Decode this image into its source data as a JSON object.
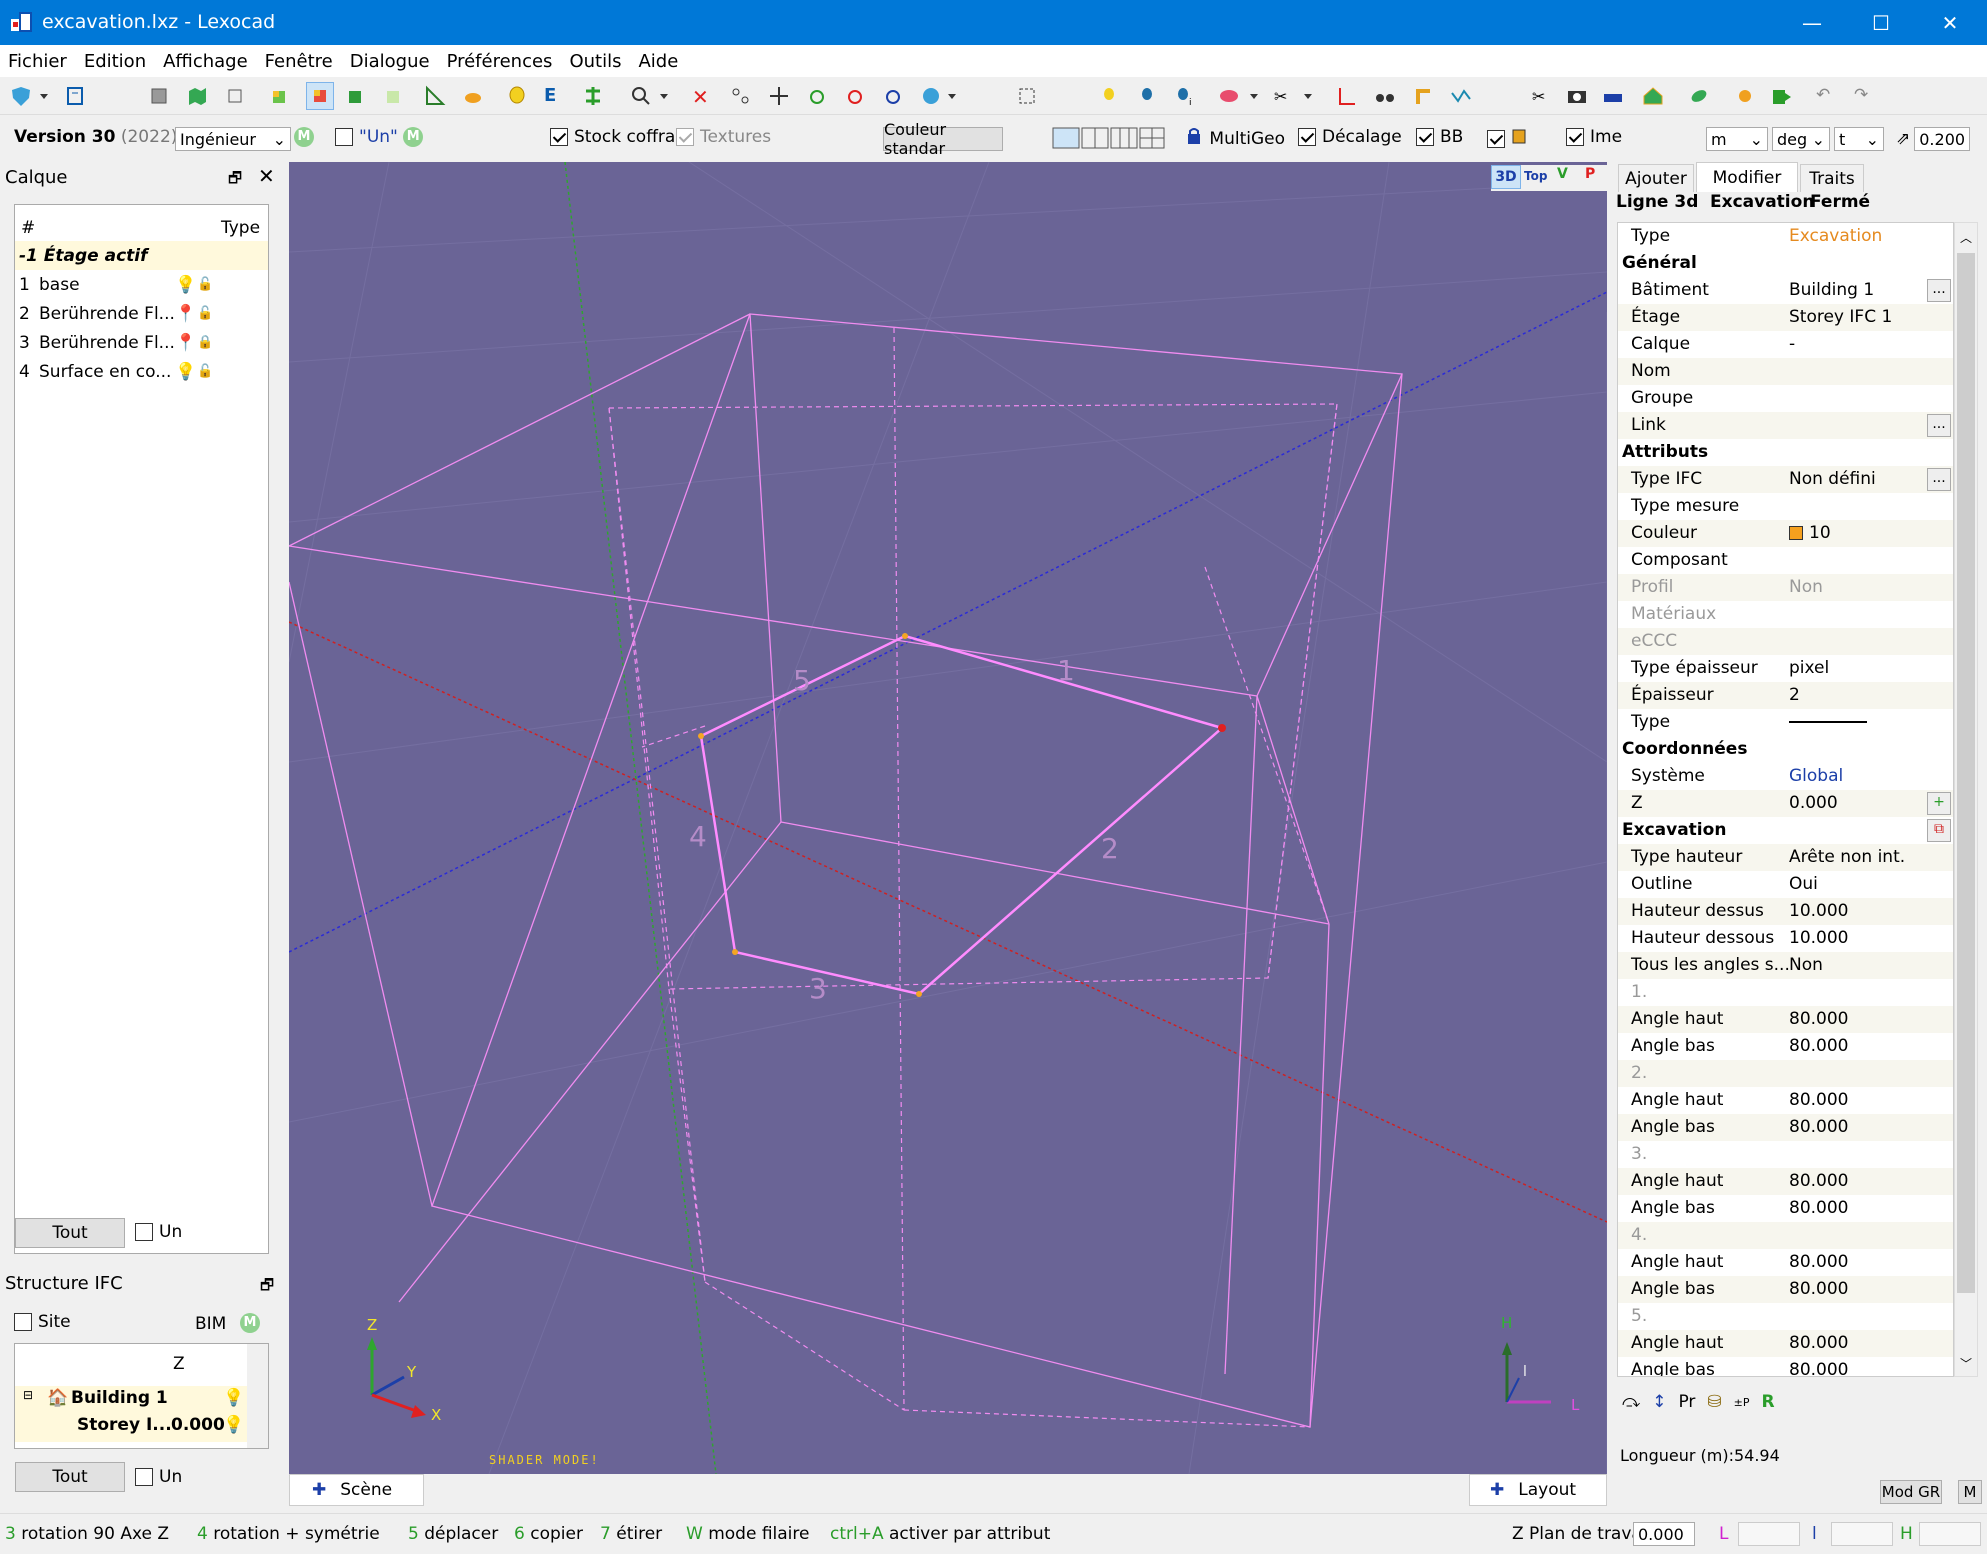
{
  "window": {
    "title": "excavation.lxz - Lexocad",
    "minimize": "—",
    "maximize": "☐",
    "close": "✕"
  },
  "menu": [
    "Fichier",
    "Edition",
    "Affichage",
    "Fenêtre",
    "Dialogue",
    "Préférences",
    "Outils",
    "Aide"
  ],
  "optbar": {
    "version_label": "Version 30",
    "version_year": "(2022)",
    "profile": "Ingénieur",
    "un_label": "\"Un\"",
    "m_badge": "M",
    "stock": "Stock coffrag",
    "textures": "Textures",
    "couleur": "Couleur standar",
    "multigeo": "MultiGeo",
    "decalage": "Décalage",
    "bb": "BB",
    "ime": "Ime",
    "unit_len": "m",
    "unit_ang": "deg",
    "unit_mass": "t",
    "value": "0.200"
  },
  "calque": {
    "title": "Calque",
    "col_num": "#",
    "col_type": "Type",
    "active": "-1 Étage actif",
    "rows": [
      {
        "n": "1",
        "name": "base"
      },
      {
        "n": "2",
        "name": "Berührende Fl..."
      },
      {
        "n": "3",
        "name": "Berührende Fl..."
      },
      {
        "n": "4",
        "name": "Surface en co..."
      }
    ],
    "tout": "Tout",
    "un": "Un"
  },
  "ifc": {
    "title": "Structure IFC",
    "site": "Site",
    "bim": "BIM",
    "m": "M",
    "col_z": "Z",
    "building": "Building 1",
    "storey": "Storey I...",
    "storey_z": "0.000",
    "tout": "Tout",
    "un": "Un"
  },
  "viewport": {
    "view_3d": "3D",
    "view_top": "Top",
    "view_v": "V",
    "view_p": "P",
    "shader": "SHADER MODE!",
    "edge_labels": [
      "1",
      "2",
      "3",
      "4",
      "5"
    ],
    "axis_z": "Z",
    "axis_y": "Y",
    "axis_x": "X",
    "axis_h": "H",
    "axis_l": "L",
    "axis_i": "l"
  },
  "bottom_tabs": {
    "scene": "Scène",
    "layout": "Layout"
  },
  "right": {
    "tabs": [
      "Ajouter",
      "Modifier",
      "Traits"
    ],
    "header": {
      "a": "Ligne 3d",
      "b": "Excavation",
      "c": "Fermé"
    },
    "rows": [
      {
        "k": "Type",
        "v": "Excavation",
        "kind": "orange"
      },
      {
        "k": "Général",
        "kind": "sec"
      },
      {
        "k": "Bâtiment",
        "v": "Building 1",
        "dots": true
      },
      {
        "k": "Étage",
        "v": "Storey IFC 1"
      },
      {
        "k": "Calque",
        "v": "-"
      },
      {
        "k": "Nom",
        "v": ""
      },
      {
        "k": "Groupe",
        "v": ""
      },
      {
        "k": "Link",
        "v": "",
        "dots": true
      },
      {
        "k": "Attributs",
        "kind": "sec"
      },
      {
        "k": "Type IFC",
        "v": "Non défini",
        "dots": true
      },
      {
        "k": "Type mesure",
        "v": ""
      },
      {
        "k": "Couleur",
        "v": "10",
        "kind": "color"
      },
      {
        "k": "Composant",
        "v": ""
      },
      {
        "k": "Profil",
        "v": "Non",
        "kind": "gray"
      },
      {
        "k": "Matériaux",
        "v": "",
        "kind": "gray"
      },
      {
        "k": "eCCC",
        "v": "",
        "kind": "gray"
      },
      {
        "k": "Type épaisseur",
        "v": "pixel"
      },
      {
        "k": "Épaisseur",
        "v": "2"
      },
      {
        "k": "Type",
        "v": "",
        "kind": "line"
      },
      {
        "k": "Coordonnées",
        "kind": "sec"
      },
      {
        "k": "Système",
        "v": "Global",
        "kind": "blue"
      },
      {
        "k": "Z",
        "v": "0.000",
        "kind": "plus"
      },
      {
        "k": "Excavation",
        "kind": "sec"
      },
      {
        "k": "Type hauteur",
        "v": "Arête non int."
      },
      {
        "k": "Outline",
        "v": "Oui"
      },
      {
        "k": "Hauteur dessus",
        "v": "10.000"
      },
      {
        "k": "Hauteur dessous",
        "v": "10.000"
      },
      {
        "k": "Tous les angles s...",
        "v": "Non"
      },
      {
        "k": "1.",
        "v": "",
        "kind": "gray"
      },
      {
        "k": "Angle haut",
        "v": "80.000"
      },
      {
        "k": "Angle bas",
        "v": "80.000"
      },
      {
        "k": "2.",
        "v": "",
        "kind": "gray"
      },
      {
        "k": "Angle haut",
        "v": "80.000"
      },
      {
        "k": "Angle bas",
        "v": "80.000"
      },
      {
        "k": "3.",
        "v": "",
        "kind": "gray"
      },
      {
        "k": "Angle haut",
        "v": "80.000"
      },
      {
        "k": "Angle bas",
        "v": "80.000"
      },
      {
        "k": "4.",
        "v": "",
        "kind": "gray"
      },
      {
        "k": "Angle haut",
        "v": "80.000"
      },
      {
        "k": "Angle bas",
        "v": "80.000"
      },
      {
        "k": "5.",
        "v": "",
        "kind": "gray"
      },
      {
        "k": "Angle haut",
        "v": "80.000"
      },
      {
        "k": "Angle bas",
        "v": "80.000"
      }
    ],
    "bottom_icons": {
      "pr": "Pr",
      "r": "R",
      "ep": "±P"
    },
    "length": "Longueur (m):54.94",
    "modgr": "Mod GR",
    "m": "M"
  },
  "status": {
    "items": [
      {
        "key": "3",
        "text": "rotation 90 Axe Z"
      },
      {
        "key": "4",
        "text": "rotation + symétrie"
      },
      {
        "key": "5",
        "text": "déplacer"
      },
      {
        "key": "6",
        "text": "copier"
      },
      {
        "key": "7",
        "text": "étirer"
      },
      {
        "key": "W",
        "text": "mode filaire"
      },
      {
        "key": "ctrl+A",
        "text": "activer par attribut"
      }
    ],
    "zplan": "Z Plan de travail",
    "zval": "0.000",
    "l": "L",
    "i": "l",
    "h": "H"
  },
  "colors": {
    "accent": "#0078d7",
    "viewport": "#6a6496",
    "wire": "#f08cf0",
    "orange": "#e58a1f"
  }
}
